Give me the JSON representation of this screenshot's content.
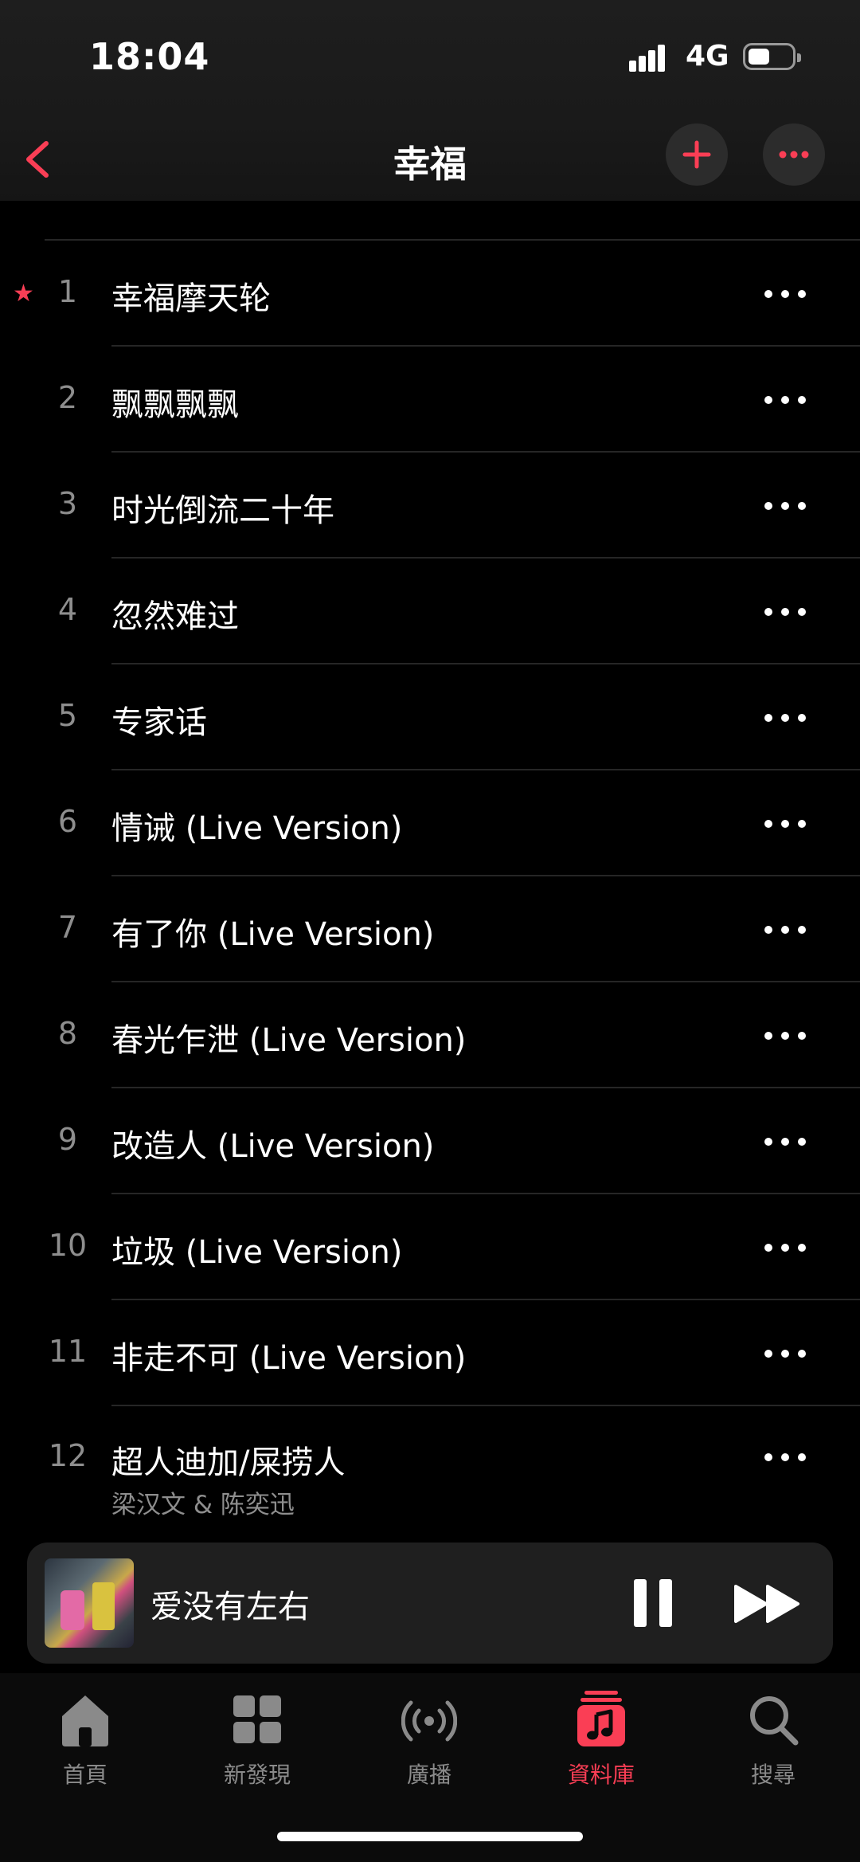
{
  "status": {
    "time": "18:04",
    "network": "4G"
  },
  "nav": {
    "title": "幸福",
    "add_icon": "plus-icon",
    "more_icon": "ellipsis-icon",
    "back_icon": "chevron-left-icon"
  },
  "colors": {
    "accent": "#fa3e55",
    "background": "#000000",
    "secondary_text": "#8e8e8e"
  },
  "tracks": [
    {
      "num": "1",
      "title": "幸福摩天轮",
      "favorite": true
    },
    {
      "num": "2",
      "title": "飘飘飘飘"
    },
    {
      "num": "3",
      "title": "时光倒流二十年"
    },
    {
      "num": "4",
      "title": "忽然难过"
    },
    {
      "num": "5",
      "title": "专家话"
    },
    {
      "num": "6",
      "title": "情诫 (Live Version)"
    },
    {
      "num": "7",
      "title": "有了你 (Live Version)"
    },
    {
      "num": "8",
      "title": "春光乍泄 (Live Version)"
    },
    {
      "num": "9",
      "title": "改造人 (Live Version)"
    },
    {
      "num": "10",
      "title": "垃圾 (Live Version)"
    },
    {
      "num": "11",
      "title": "非走不可 (Live Version)"
    },
    {
      "num": "12",
      "title": "超人迪加/屎捞人",
      "artist": "梁汉文 & 陈奕迅"
    }
  ],
  "now_playing": {
    "title": "爱没有左右",
    "state": "playing"
  },
  "tabs": [
    {
      "label": "首頁",
      "icon": "home-icon"
    },
    {
      "label": "新發現",
      "icon": "grid-icon"
    },
    {
      "label": "廣播",
      "icon": "radio-icon"
    },
    {
      "label": "資料庫",
      "icon": "library-icon",
      "active": true
    },
    {
      "label": "搜尋",
      "icon": "search-icon"
    }
  ]
}
